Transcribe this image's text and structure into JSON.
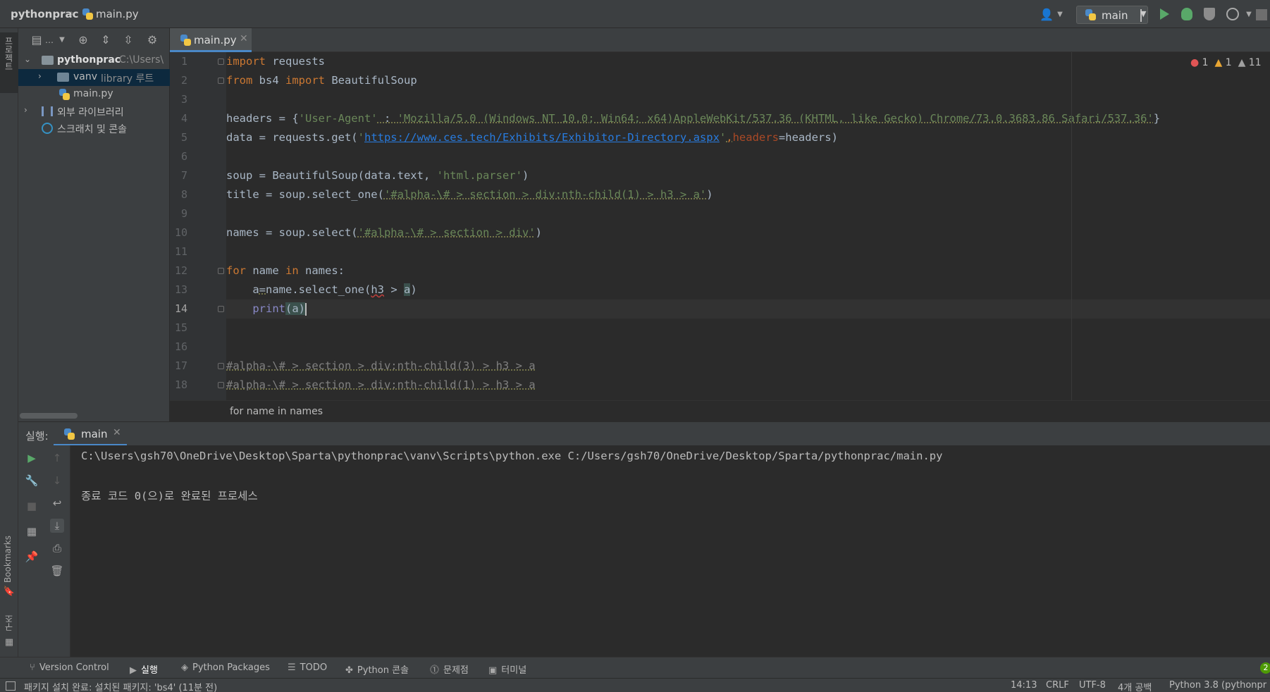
{
  "breadcrumb": {
    "project": "pythonprac",
    "file": "main.py"
  },
  "run_config": {
    "label": "main"
  },
  "left_strip": {
    "project_label": "프로젝트",
    "bookmarks_label": "Bookmarks",
    "structure_label": "구조"
  },
  "project_tree": {
    "root": {
      "name": "pythonprac",
      "path": "C:\\Users\\"
    },
    "vanv": {
      "name": "vanv",
      "hint": "library 루트"
    },
    "main": {
      "name": "main.py"
    },
    "external": {
      "name": "외부 라이브러리"
    },
    "scratch": {
      "name": "스크래치 및 콘솔"
    }
  },
  "editor": {
    "tab_label": "main.py",
    "inspections": {
      "errors": "1",
      "warnings": "1",
      "weak_warnings": "11"
    },
    "line_numbers": [
      "1",
      "2",
      "3",
      "4",
      "5",
      "6",
      "7",
      "8",
      "9",
      "10",
      "11",
      "12",
      "13",
      "14",
      "15",
      "16",
      "17",
      "18"
    ],
    "code": {
      "l1_kw": "import",
      "l1_rest": " requests",
      "l2_kw1": "from",
      "l2_mid": " bs4 ",
      "l2_kw2": "import",
      "l2_rest": " BeautifulSoup",
      "l4_a": "headers = {",
      "l4_key": "'User-Agent'",
      "l4_colon": " : ",
      "l4_val": "'Mozilla/5.0 (Windows NT 10.0; Win64; x64)AppleWebKit/537.36 (KHTML, like Gecko) Chrome/73.0.3683.86 Safari/537.36'",
      "l4_end": "}",
      "l5_a": "data = requests.get(",
      "l5_q1": "'",
      "l5_url": "https://www.ces.tech/Exhibits/Exhibitor-Directory.aspx",
      "l5_q2": "'",
      "l5_comma": ",",
      "l5_param": "headers",
      "l5_end": "=headers)",
      "l7_a": "soup = BeautifulSoup(data.text, ",
      "l7_str": "'html.parser'",
      "l7_end": ")",
      "l8_a": "title = soup.select_one(",
      "l8_str": "'#alpha-\\# > section > div:nth-child(1) > h3 > a'",
      "l8_end": ")",
      "l10_a": "names = soup.select(",
      "l10_str": "'#alpha-\\# > section > div'",
      "l10_end": ")",
      "l12_kw1": "for",
      "l12_mid": " name ",
      "l12_kw2": "in",
      "l12_rest": " names:",
      "l13_a": "    a",
      "l13_eq": "=",
      "l13_b": "name.select_one(",
      "l13_h3": "h3",
      "l13_c": " > ",
      "l13_a2": "a",
      "l13_end": ")",
      "l14_indent": "    ",
      "l14_fn": "print",
      "l14_paren": "(a)",
      "l17": "#alpha-\\# > section > div:nth-child(3) > h3 > a",
      "l18": "#alpha-\\# > section > div:nth-child(1) > h3 > a"
    },
    "breadcrumb": "for name in names"
  },
  "run_panel": {
    "title": "실행:",
    "tab_label": "main",
    "output": [
      "C:\\Users\\gsh70\\OneDrive\\Desktop\\Sparta\\pythonprac\\vanv\\Scripts\\python.exe C:/Users/gsh70/OneDrive/Desktop/Sparta/pythonprac/main.py",
      "종료 코드 0(으)로 완료된 프로세스"
    ]
  },
  "bottom_tools": {
    "version_control": "Version Control",
    "run": "실행",
    "packages": "Python Packages",
    "todo": "TODO",
    "console": "Python 콘솔",
    "problems": "문제점",
    "terminal": "터미널"
  },
  "status": {
    "message": "패키지 설치 완료: 설치된 패키지: 'bs4' (11분 전)",
    "position": "14:13",
    "line_sep": "CRLF",
    "encoding": "UTF-8",
    "indent": "4개 공백",
    "interpreter": "Python 3.8 (pythonpr",
    "badge": "2"
  },
  "colors": {
    "accent": "#4a88c7",
    "run_green": "#59a869",
    "keyword": "#cc7832",
    "string": "#6a8759",
    "link": "#287bde"
  }
}
